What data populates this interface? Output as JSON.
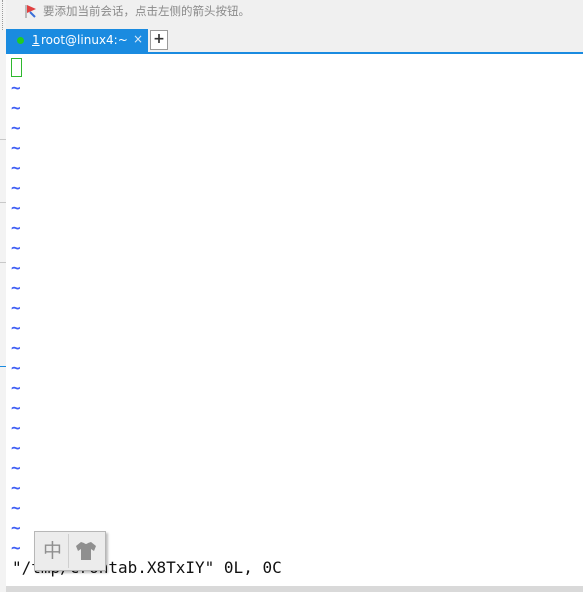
{
  "hint_bar": {
    "text": "要添加当前会话，点击左侧的箭头按钮。",
    "icon": "red-arrow-bookmark-icon"
  },
  "tabs": [
    {
      "number": "1",
      "title": "root@linux4:~",
      "close": "×",
      "active": true,
      "status_color": "#22cc22"
    }
  ],
  "add_tab_label": "+",
  "terminal": {
    "tilde": "~",
    "tilde_count": 24,
    "status_line": "\"/tmp/crontab.X8TxIY\" 0L, 0C"
  },
  "ime": {
    "mode_label": "中",
    "skin_icon": "shirt-icon"
  },
  "colors": {
    "accent": "#1a8be0",
    "tilde": "#3b5bf5",
    "cursor": "#2eb82e"
  }
}
